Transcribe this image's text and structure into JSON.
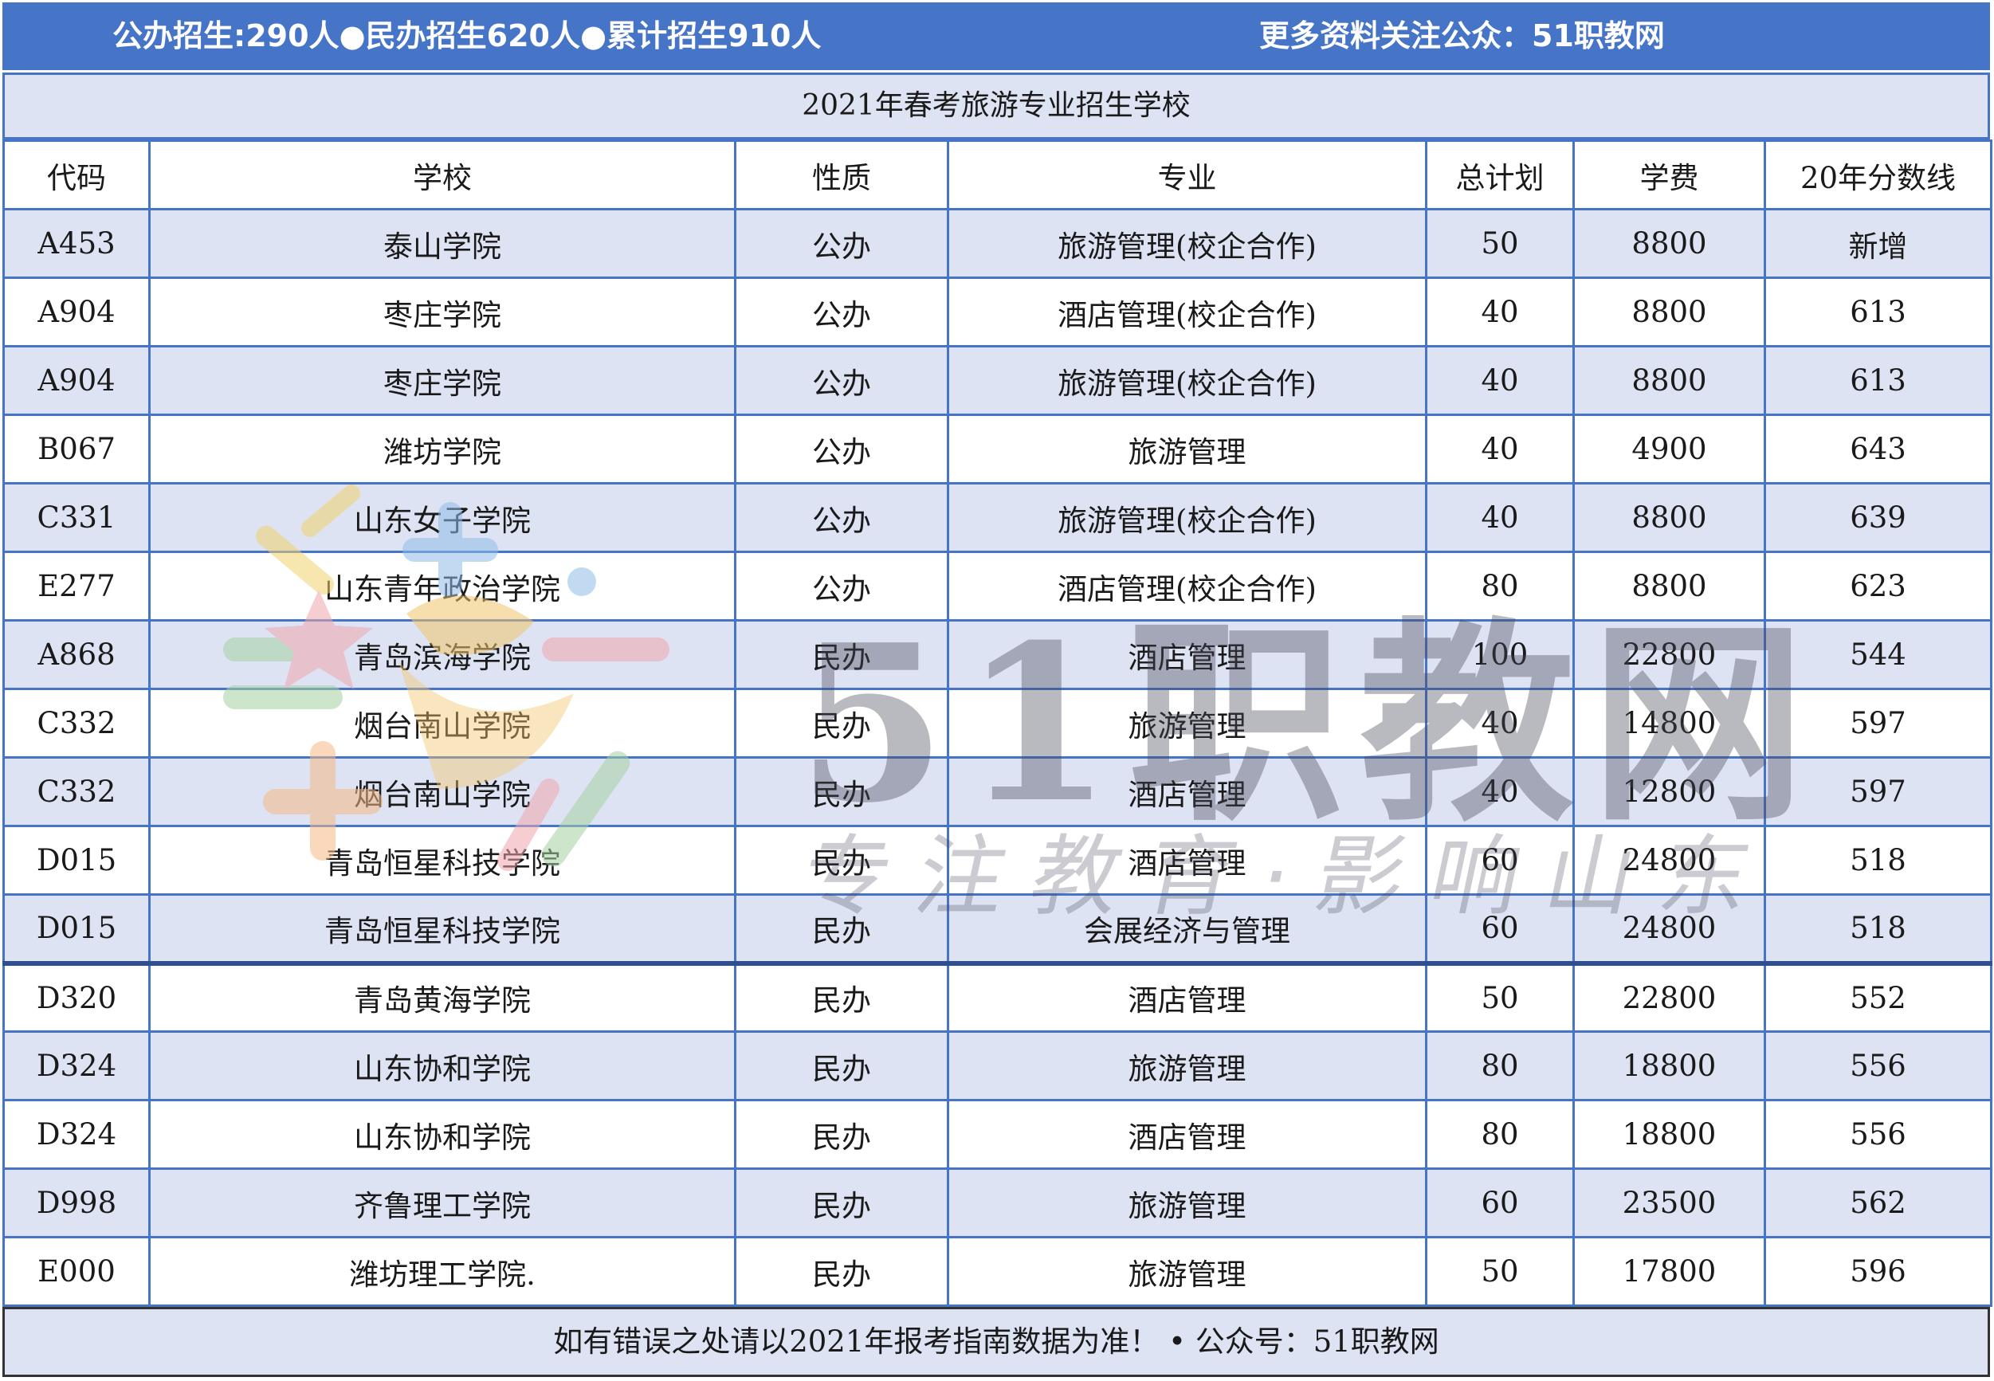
{
  "banner": {
    "left_text": "公办招生:290人●民办招生620人●累计招生910人",
    "right_text": "更多资料关注公众：51职教网"
  },
  "title": "2021年春考旅游专业招生学校",
  "headers": [
    "代码",
    "学校",
    "性质",
    "专业",
    "总计划",
    "学费",
    "20年分数线"
  ],
  "rows": [
    [
      "A453",
      "泰山学院",
      "公办",
      "旅游管理(校企合作)",
      "50",
      "8800",
      "新增"
    ],
    [
      "A904",
      "枣庄学院",
      "公办",
      "酒店管理(校企合作)",
      "40",
      "8800",
      "613"
    ],
    [
      "A904",
      "枣庄学院",
      "公办",
      "旅游管理(校企合作)",
      "40",
      "8800",
      "613"
    ],
    [
      "B067",
      "潍坊学院",
      "公办",
      "旅游管理",
      "40",
      "4900",
      "643"
    ],
    [
      "C331",
      "山东女子学院",
      "公办",
      "旅游管理(校企合作)",
      "40",
      "8800",
      "639"
    ],
    [
      "E277",
      "山东青年政治学院",
      "公办",
      "酒店管理(校企合作)",
      "80",
      "8800",
      "623"
    ],
    [
      "A868",
      "青岛滨海学院",
      "民办",
      "酒店管理",
      "100",
      "22800",
      "544"
    ],
    [
      "C332",
      "烟台南山学院",
      "民办",
      "旅游管理",
      "40",
      "14800",
      "597"
    ],
    [
      "C332",
      "烟台南山学院",
      "民办",
      "酒店管理",
      "40",
      "12800",
      "597"
    ],
    [
      "D015",
      "青岛恒星科技学院",
      "民办",
      "酒店管理",
      "60",
      "24800",
      "518"
    ],
    [
      "D015",
      "青岛恒星科技学院",
      "民办",
      "会展经济与管理",
      "60",
      "24800",
      "518"
    ],
    [
      "D320",
      "青岛黄海学院",
      "民办",
      "酒店管理",
      "50",
      "22800",
      "552"
    ],
    [
      "D324",
      "山东协和学院",
      "民办",
      "旅游管理",
      "80",
      "18800",
      "556"
    ],
    [
      "D324",
      "山东协和学院",
      "民办",
      "酒店管理",
      "80",
      "18800",
      "556"
    ],
    [
      "D998",
      "齐鲁理工学院",
      "民办",
      "旅游管理",
      "60",
      "23500",
      "562"
    ],
    [
      "E000",
      "潍坊理工学院.",
      "民办",
      "旅游管理",
      "50",
      "17800",
      "596"
    ]
  ],
  "footer": "如有错误之处请以2021年报考指南数据为准！ • 公众号：51职教网",
  "watermark": {
    "main": "51职教网",
    "sub": "专注教育·影响山东"
  },
  "colors": {
    "banner": "#4674c7",
    "row_shade": "#dde3f3",
    "border": "#4674c7"
  }
}
